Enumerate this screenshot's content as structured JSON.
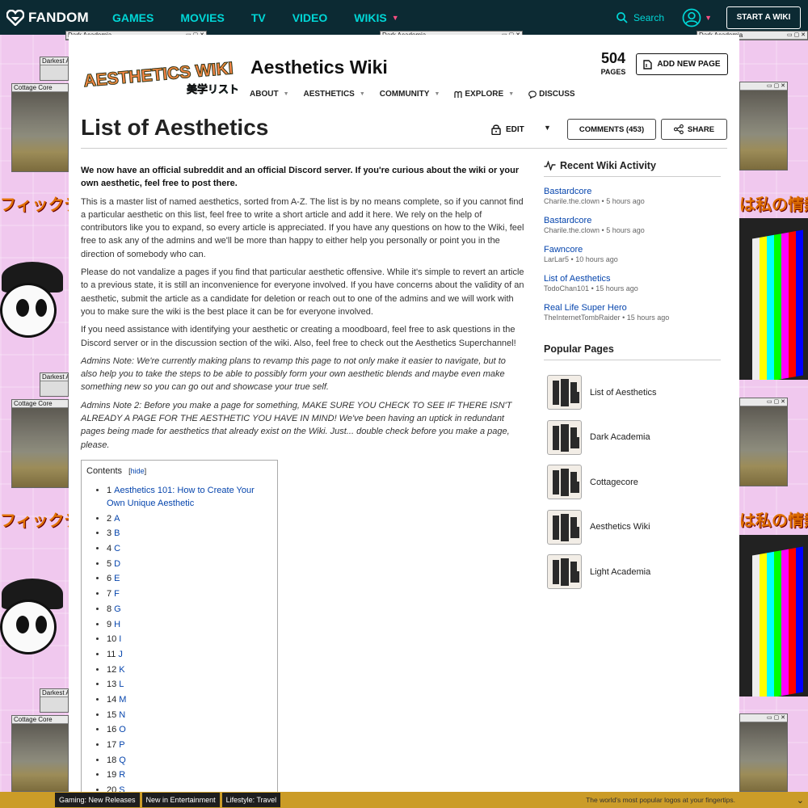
{
  "topnav": {
    "brand": "FANDOM",
    "links": [
      {
        "label": "GAMES",
        "has_dropdown": false
      },
      {
        "label": "MOVIES",
        "has_dropdown": false
      },
      {
        "label": "TV",
        "has_dropdown": false
      },
      {
        "label": "VIDEO",
        "has_dropdown": false
      },
      {
        "label": "WIKIS",
        "has_dropdown": true
      }
    ],
    "search_label": "Search",
    "start_wiki_label": "START A WIKI"
  },
  "background": {
    "window_titles": [
      "Dark Academia",
      "Darkest A",
      "Cottage Core"
    ],
    "jp_left": "フィックデザ",
    "jp_right": "は私の情熱"
  },
  "wiki": {
    "name": "Aesthetics Wiki",
    "logo_text": "AESTHETICS WIKI",
    "logo_sub": "美学リスト",
    "pages_count": "504",
    "pages_label": "PAGES",
    "add_page_label": "ADD NEW PAGE",
    "nav": [
      {
        "label": "ABOUT",
        "dropdown": true
      },
      {
        "label": "AESTHETICS",
        "dropdown": true
      },
      {
        "label": "COMMUNITY",
        "dropdown": true
      },
      {
        "label": "EXPLORE",
        "dropdown": true,
        "icon": "explore-icon"
      },
      {
        "label": "DISCUSS",
        "dropdown": false,
        "icon": "discuss-icon"
      }
    ]
  },
  "page": {
    "title": "List of Aesthetics",
    "edit_label": "EDIT",
    "comments_label": "COMMENTS (453)",
    "share_label": "SHARE",
    "paragraphs": [
      {
        "style": "bold",
        "text": "We now have an official subreddit and an official Discord server. If you're curious about the wiki or your own aesthetic, feel free to post there."
      },
      {
        "style": "normal",
        "text": "This is a master list of named aesthetics, sorted from A-Z. The list is by no means complete, so if you cannot find a particular aesthetic on this list, feel free to write a short article and add it here. We rely on the help of contributors like you to expand, so every article is appreciated. If you have any questions on how to the Wiki, feel free to ask any of the admins and we'll be more than happy to either help you personally or point you in the direction of somebody who can."
      },
      {
        "style": "normal",
        "text": "Please do not vandalize a pages if you find that particular aesthetic offensive. While it's simple to revert an article to a previous state, it is still an inconvenience for everyone involved. If you have concerns about the validity of an aesthetic, submit the article as a candidate for deletion or reach out to one of the admins and we will work with you to make sure the wiki is the best place it can be for everyone involved."
      },
      {
        "style": "normal",
        "text": "If you need assistance with identifying your aesthetic or creating a moodboard, feel free to ask questions in the Discord server or in the discussion section of the wiki. Also, feel free to check out the Aesthetics Superchannel!"
      },
      {
        "style": "italic",
        "text": "Admins Note: We're currently making plans to revamp this page to not only make it easier to navigate, but to also help you to take the steps to be able to possibly form your own aesthetic blends and maybe even make something new so you can go out and showcase your true self."
      },
      {
        "style": "italic",
        "text": "Admins Note 2: Before you make a page for something, MAKE SURE YOU CHECK TO SEE IF THERE ISN'T ALREADY A PAGE FOR THE AESTHETIC YOU HAVE IN MIND! We've been having an uptick in redundant pages being made for aesthetics that already exist on the Wiki. Just... double check before you make a page, please."
      }
    ],
    "toc": {
      "title": "Contents",
      "hide_label": "hide",
      "items": [
        {
          "num": "1",
          "label": "Aesthetics 101: How to Create Your Own Unique Aesthetic"
        },
        {
          "num": "2",
          "label": "A"
        },
        {
          "num": "3",
          "label": "B"
        },
        {
          "num": "4",
          "label": "C"
        },
        {
          "num": "5",
          "label": "D"
        },
        {
          "num": "6",
          "label": "E"
        },
        {
          "num": "7",
          "label": "F"
        },
        {
          "num": "8",
          "label": "G"
        },
        {
          "num": "9",
          "label": "H"
        },
        {
          "num": "10",
          "label": "I"
        },
        {
          "num": "11",
          "label": "J"
        },
        {
          "num": "12",
          "label": "K"
        },
        {
          "num": "13",
          "label": "L"
        },
        {
          "num": "14",
          "label": "M"
        },
        {
          "num": "15",
          "label": "N"
        },
        {
          "num": "16",
          "label": "O"
        },
        {
          "num": "17",
          "label": "P"
        },
        {
          "num": "18",
          "label": "Q"
        },
        {
          "num": "19",
          "label": "R"
        },
        {
          "num": "20",
          "label": "S"
        }
      ]
    }
  },
  "rail": {
    "activity_title": "Recent Wiki Activity",
    "activity": [
      {
        "title": "Bastardcore",
        "user": "Charile.the.clown",
        "time": "5 hours ago"
      },
      {
        "title": "Bastardcore",
        "user": "Charile.the.clown",
        "time": "5 hours ago"
      },
      {
        "title": "Fawncore",
        "user": "LarLar5",
        "time": "10 hours ago"
      },
      {
        "title": "List of Aesthetics",
        "user": "TodoChan101",
        "time": "15 hours ago"
      },
      {
        "title": "Real Life Super Hero",
        "user": "TheInternetTombRaider",
        "time": "15 hours ago"
      }
    ],
    "popular_title": "Popular Pages",
    "popular": [
      {
        "label": "List of Aesthetics"
      },
      {
        "label": "Dark Academia"
      },
      {
        "label": "Cottagecore"
      },
      {
        "label": "Aesthetics Wiki"
      },
      {
        "label": "Light Academia"
      }
    ]
  },
  "bottom_bar": {
    "tabs": [
      "Gaming: New Releases",
      "New in Entertainment",
      "Lifestyle: Travel"
    ],
    "promo": "The world's most popular logos at your fingertips."
  },
  "colors": {
    "topnav_bg": "#0c2a33",
    "accent_teal": "#00d6d6",
    "accent_pink": "#ff4f83",
    "link_blue": "#0645ad",
    "bottom_bar_bg": "#cb9c28",
    "background_pink": "#f0c8ee"
  }
}
